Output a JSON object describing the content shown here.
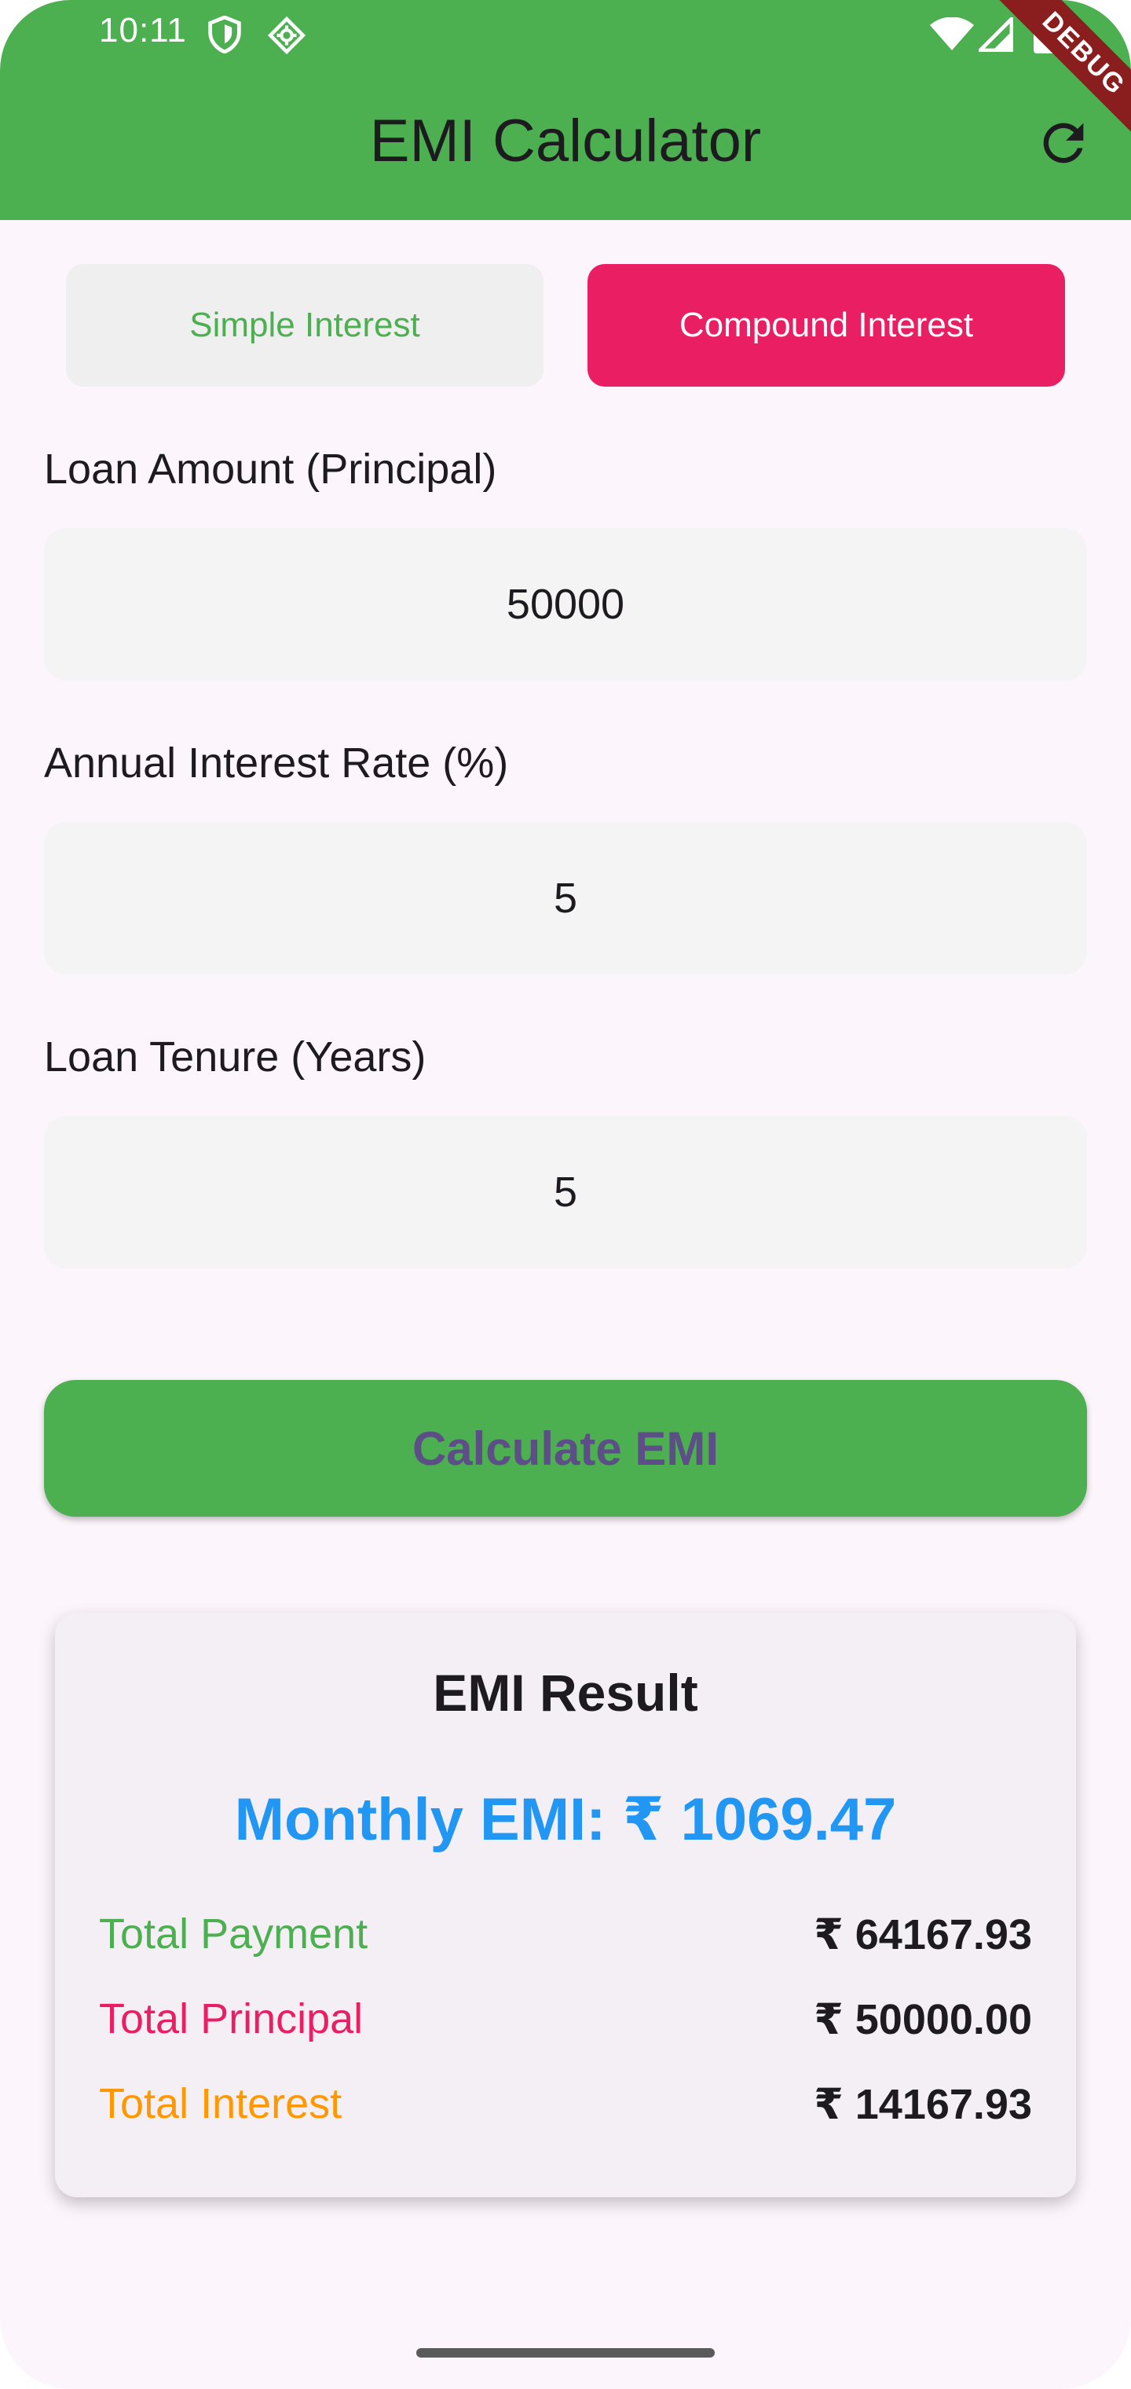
{
  "status_bar": {
    "time": "10:11",
    "icons": [
      "shield-icon",
      "gear-icon",
      "wifi-icon",
      "signal-icon",
      "battery-icon"
    ]
  },
  "app_bar": {
    "title": "EMI Calculator",
    "refresh_icon": "refresh-icon",
    "debug_banner": "DEBUG",
    "color": "#4caf50"
  },
  "toggles": {
    "simple_label": "Simple Interest",
    "compound_label": "Compound Interest",
    "selected": "Compound Interest",
    "selected_color": "#e91e63"
  },
  "form": {
    "principal_label": "Loan Amount (Principal)",
    "principal_value": "50000",
    "rate_label": "Annual Interest Rate (%)",
    "rate_value": "5",
    "tenure_label": "Loan Tenure (Years)",
    "tenure_value": "5"
  },
  "calculate_label": "Calculate EMI",
  "result": {
    "title": "EMI Result",
    "monthly_emi": "Monthly EMI: ₹ 1069.47",
    "rows": [
      {
        "label": "Total Payment",
        "value": "₹ 64167.93",
        "color": "#4caf50"
      },
      {
        "label": "Total Principal",
        "value": "₹ 50000.00",
        "color": "#e91e63"
      },
      {
        "label": "Total Interest",
        "value": "₹ 14167.93",
        "color": "#ff9800"
      }
    ]
  }
}
